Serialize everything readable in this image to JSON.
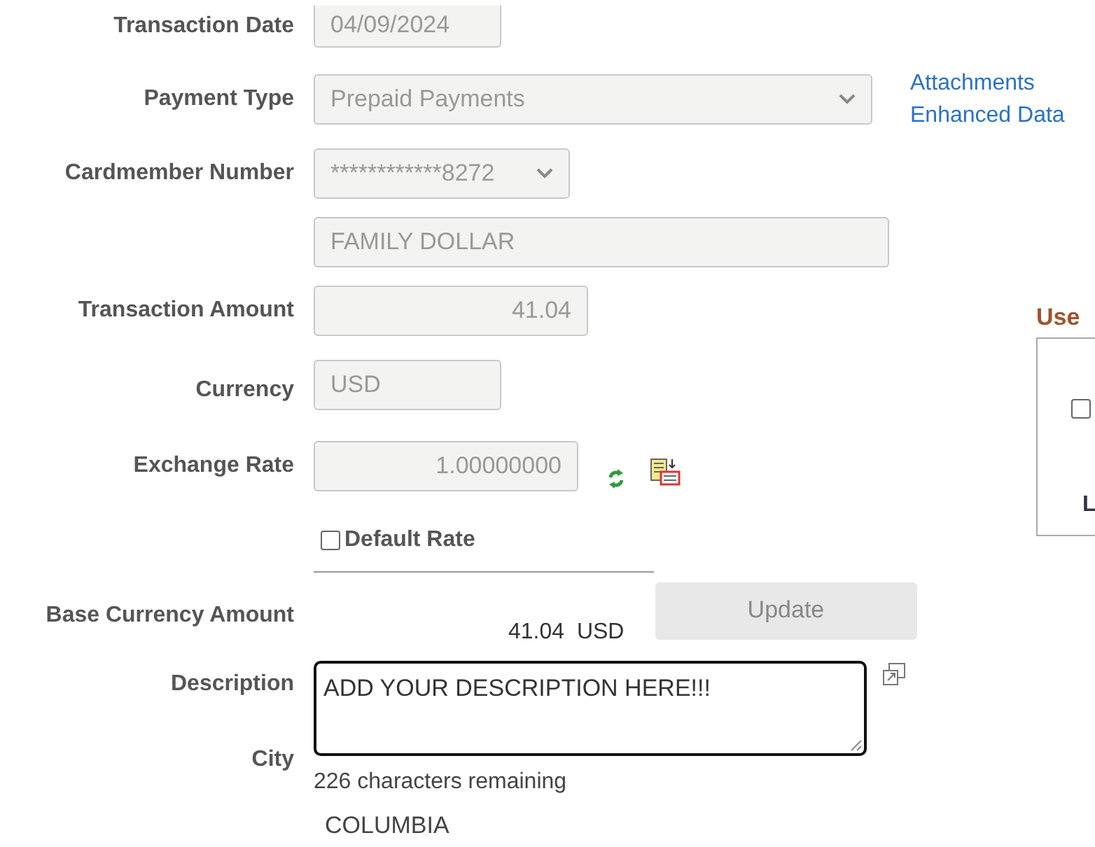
{
  "form": {
    "transaction_date": {
      "label": "Transaction Date",
      "value": "04/09/2024"
    },
    "payment_type": {
      "label": "Payment Type",
      "value": "Prepaid Payments"
    },
    "links": [
      "Attachments",
      "Enhanced Data"
    ],
    "cardmember_number": {
      "label": "Cardmember Number",
      "value": "************8272"
    },
    "merchant": {
      "value": "FAMILY DOLLAR"
    },
    "transaction_amount": {
      "label": "Transaction Amount",
      "value": "41.04"
    },
    "currency": {
      "label": "Currency",
      "value": "USD"
    },
    "exchange_rate": {
      "label": "Exchange Rate",
      "value": "1.00000000"
    },
    "default_rate": {
      "label": "Default Rate",
      "checked": false
    },
    "base_currency_amount": {
      "label": "Base Currency Amount",
      "amount": "41.04",
      "currency": "USD"
    },
    "update_button": {
      "label": "Update",
      "disabled": true
    },
    "description": {
      "label": "Description",
      "value": "ADD YOUR DESCRIPTION HERE!!!",
      "remaining": "226 characters remaining"
    },
    "city": {
      "label": "City",
      "value": "COLUMBIA"
    }
  },
  "side_panel": {
    "title": "Use",
    "checkbox": {
      "checked": false
    },
    "label": "L"
  }
}
